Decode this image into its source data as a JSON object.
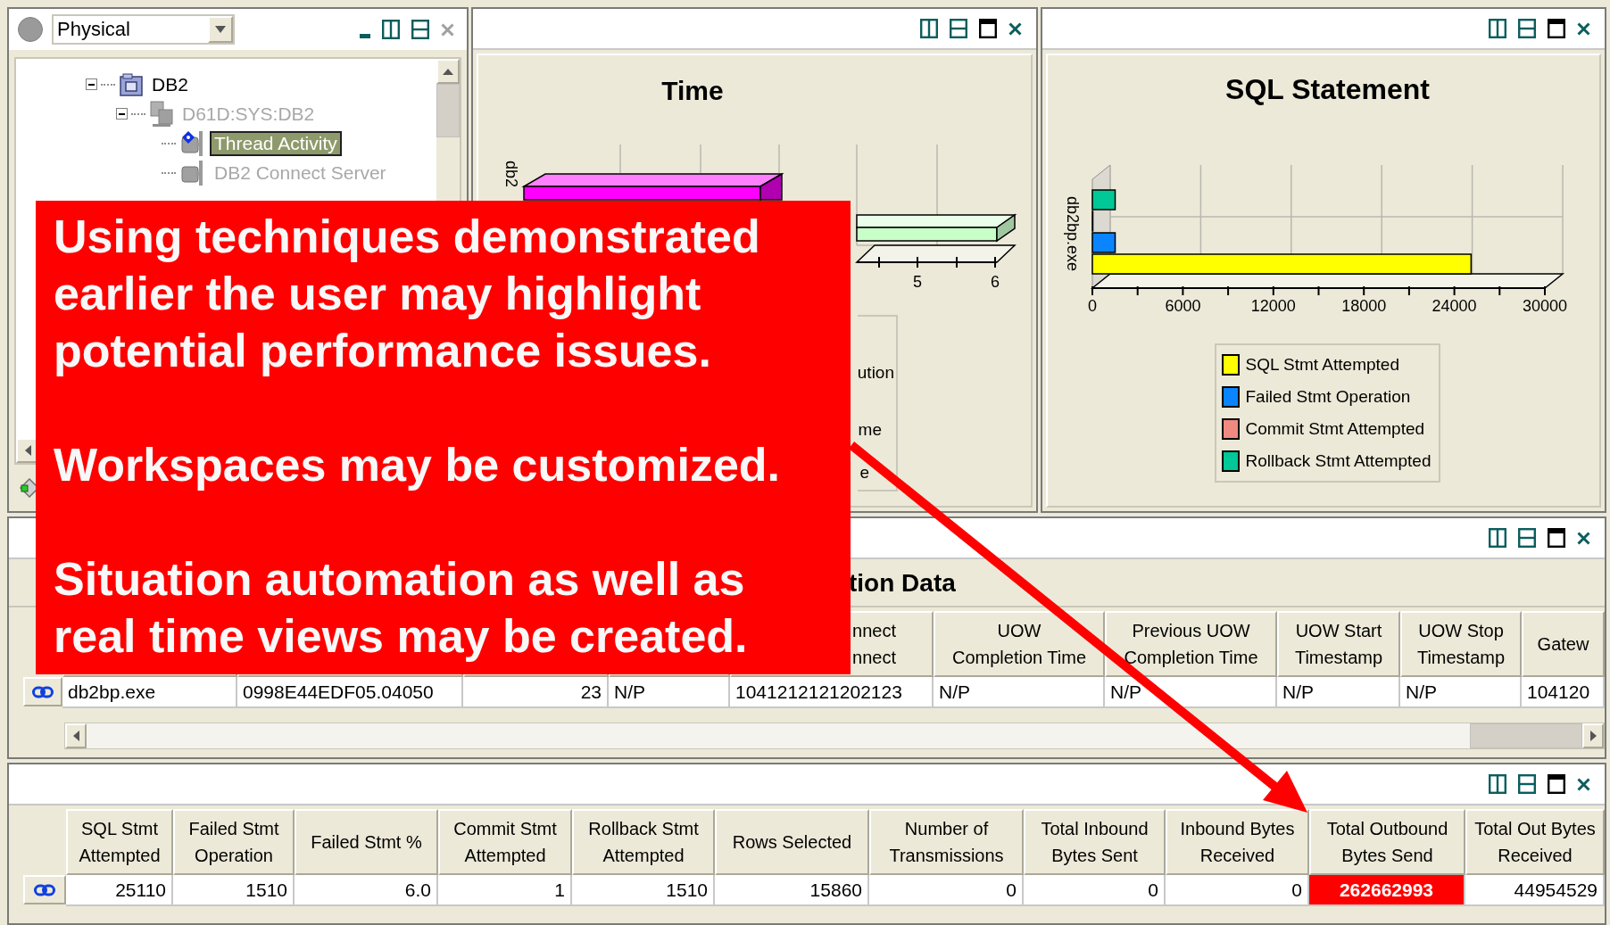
{
  "navigator": {
    "view_selector": {
      "value": "Physical"
    },
    "tree": [
      {
        "label": "DB2",
        "kind": "database",
        "expanded": true,
        "disabled": false,
        "selected": false,
        "children": [
          {
            "label": "D61D:SYS:DB2",
            "kind": "system",
            "expanded": true,
            "disabled": true,
            "selected": false,
            "children": [
              {
                "label": "Thread Activity",
                "kind": "agent",
                "flagged": true,
                "disabled": false,
                "selected": true
              },
              {
                "label": "DB2 Connect Server",
                "kind": "agent",
                "flagged": false,
                "disabled": true,
                "selected": false
              }
            ]
          }
        ]
      }
    ]
  },
  "time_chart": {
    "title": "Time",
    "axis_label": "db2",
    "tick_labels": [
      "5",
      "6"
    ],
    "legend_fragments": [
      "ution",
      "me",
      "e"
    ]
  },
  "sql_chart": {
    "chart_data": {
      "type": "bar",
      "orientation": "horizontal",
      "title": "SQL Statement",
      "categories": [
        "db2bp.exe"
      ],
      "series": [
        {
          "name": "SQL Stmt Attempted",
          "color": "#ffff00",
          "values": [
            25110
          ]
        },
        {
          "name": "Failed Stmt Operation",
          "color": "#0a84ff",
          "values": [
            1510
          ]
        },
        {
          "name": "Commit Stmt Attempted",
          "color": "#f08a80",
          "values": [
            1
          ]
        },
        {
          "name": "Rollback Stmt Attempted",
          "color": "#00c896",
          "values": [
            1510
          ]
        }
      ],
      "xlim": [
        0,
        30000
      ],
      "xticks": [
        0,
        6000,
        12000,
        18000,
        24000,
        30000
      ],
      "legend": "bottom"
    }
  },
  "connection_table": {
    "title_fragment": "tion Data",
    "headers": [
      "nnect\nnnect",
      "UOW\nCompletion Time",
      "Previous UOW\nCompletion Time",
      "UOW Start\nTimestamp",
      "UOW Stop\nTimestamp",
      "Gatew"
    ],
    "rows": [
      {
        "cells": [
          "db2bp.exe",
          "0998E44EDF05.04050",
          "23",
          "N/P",
          "1041212121202123",
          "N/P",
          "N/P",
          "N/P",
          "N/P",
          "104120"
        ]
      }
    ]
  },
  "statement_table": {
    "headers": [
      "SQL Stmt Attempted",
      "Failed Stmt Operation",
      "Failed Stmt %",
      "Commit Stmt Attempted",
      "Rollback Stmt Attempted",
      "Rows Selected",
      "Number of Transmissions",
      "Total Inbound Bytes Sent",
      "Inbound Bytes Received",
      "Total Outbound Bytes Send",
      "Total Out Bytes Received"
    ],
    "rows": [
      {
        "cells": [
          {
            "value": "25110",
            "highlighted": false
          },
          {
            "value": "1510",
            "highlighted": false
          },
          {
            "value": "6.0",
            "highlighted": false
          },
          {
            "value": "1",
            "highlighted": false
          },
          {
            "value": "1510",
            "highlighted": false
          },
          {
            "value": "15860",
            "highlighted": false
          },
          {
            "value": "0",
            "highlighted": false
          },
          {
            "value": "0",
            "highlighted": false
          },
          {
            "value": "0",
            "highlighted": false
          },
          {
            "value": "262662993",
            "highlighted": true
          },
          {
            "value": "44954529",
            "highlighted": false
          }
        ]
      }
    ]
  },
  "callout": {
    "paragraphs": [
      "Using techniques demonstrated earlier the user may highlight potential performance issues.",
      "Workspaces may be customized.",
      "Situation automation as well as real time views may be created."
    ]
  }
}
